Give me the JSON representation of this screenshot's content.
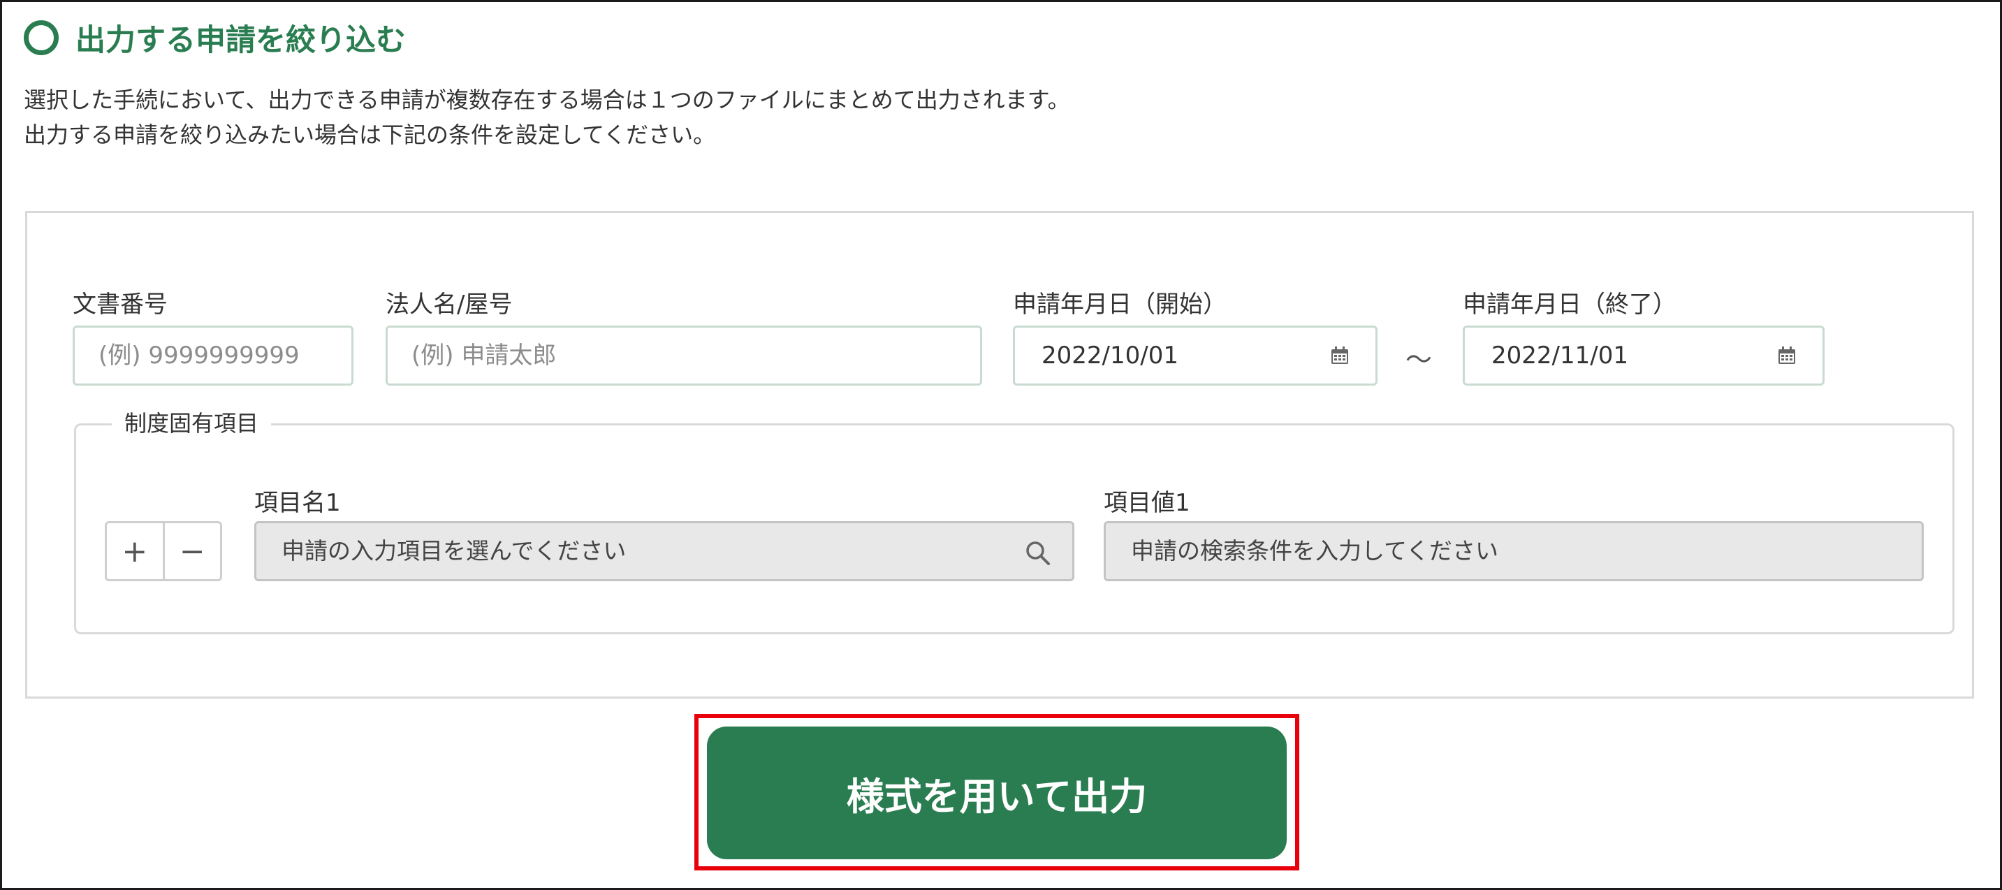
{
  "section": {
    "title": "出力する申請を絞り込む",
    "description": [
      "選択した手続において、出力できる申請が複数存在する場合は１つのファイルにまとめて出力されます。",
      "出力する申請を絞り込みたい場合は下記の条件を設定してください。"
    ]
  },
  "filters": {
    "document_number": {
      "label": "文書番号",
      "placeholder": "(例) 9999999999"
    },
    "corporate_name": {
      "label": "法人名/屋号",
      "placeholder": "(例) 申請太郎"
    },
    "date_start": {
      "label": "申請年月日（開始）",
      "value": "2022/10/01",
      "icon": "calendar-icon"
    },
    "range_separator": "～",
    "date_end": {
      "label": "申請年月日（終了）",
      "value": "2022/11/01",
      "icon": "calendar-icon"
    }
  },
  "custom_fields": {
    "legend": "制度固有項目",
    "add_label": "+",
    "remove_label": "−",
    "item_name": {
      "label": "項目名1",
      "placeholder": "申請の入力項目を選んでください",
      "icon": "search-icon"
    },
    "item_value": {
      "label": "項目値1",
      "placeholder": "申請の検索条件を入力してください"
    }
  },
  "actions": {
    "output_label": "様式を用いて出力"
  },
  "colors": {
    "accent": "#2a7d50",
    "highlight": "#e8000b"
  }
}
